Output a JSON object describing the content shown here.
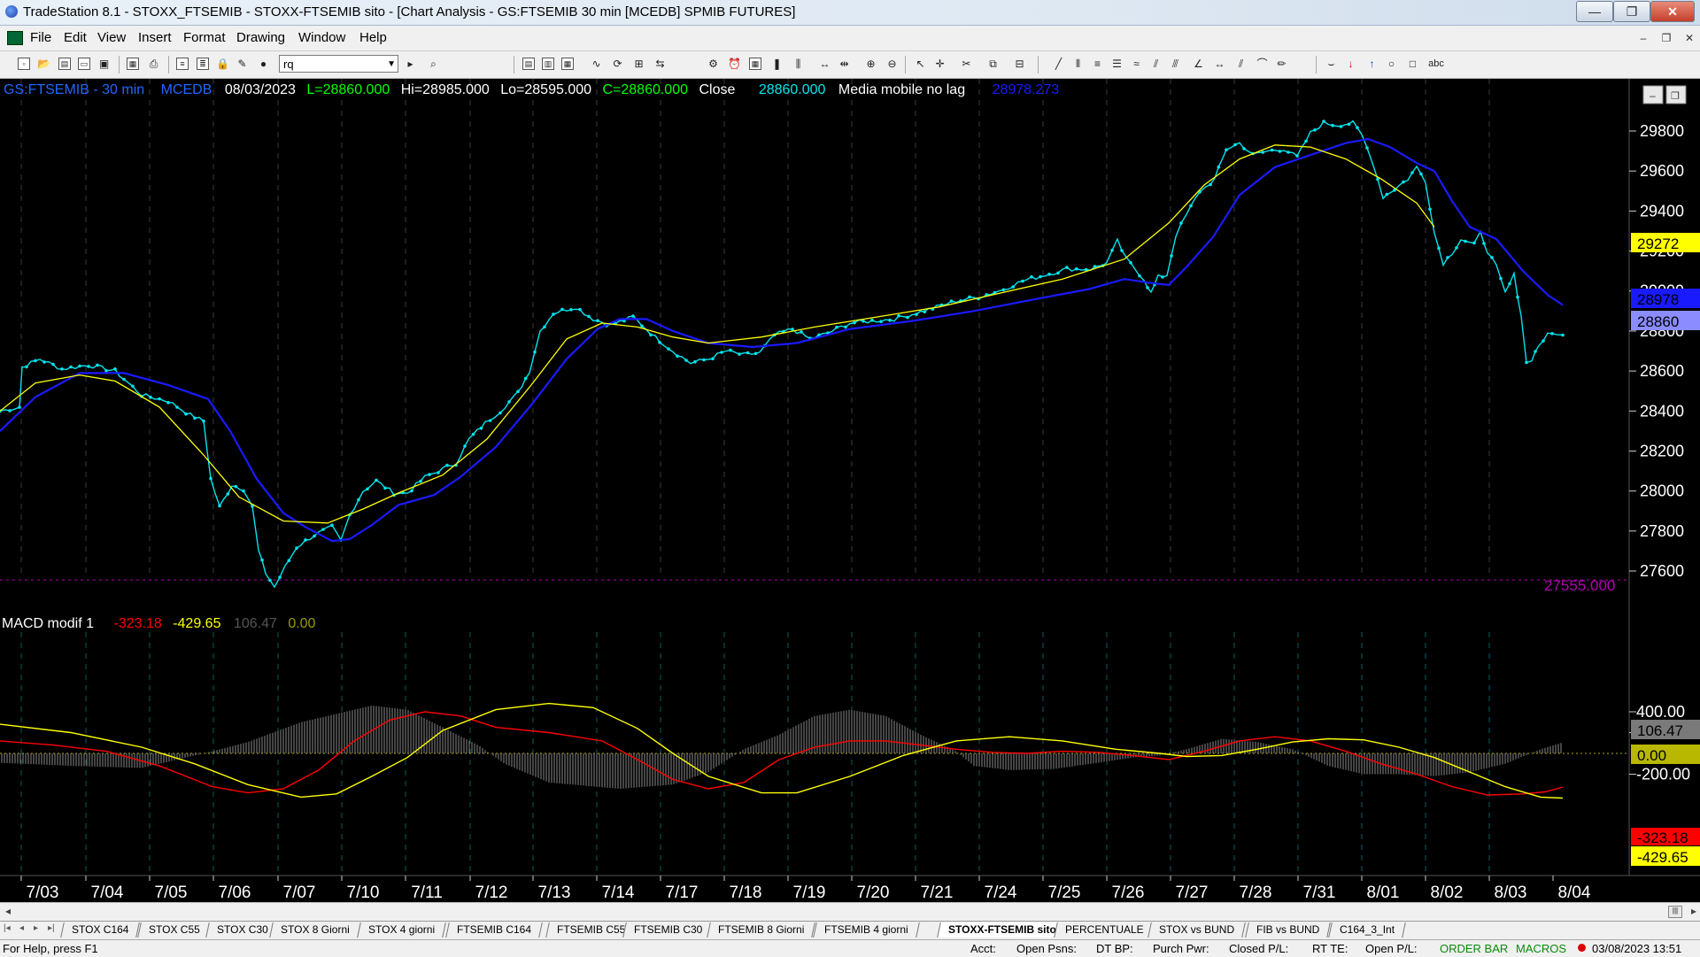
{
  "window": {
    "title": "TradeStation 8.1 - STOXX_FTSEMIB - STOXX-FTSEMIB sito - [Chart Analysis - GS:FTSEMIB  30 min  [MCEDB] SPMIB FUTURES]",
    "minimize_glyph": "—",
    "restore_glyph": "❐",
    "close_glyph": "✕"
  },
  "menu": {
    "items": [
      "File",
      "Edit",
      "View",
      "Insert",
      "Format",
      "Drawing",
      "Window",
      "Help"
    ],
    "mdi_glyphs": [
      "–",
      "❐",
      "✕"
    ]
  },
  "toolbar": {
    "symbol_value": "rq",
    "icons": [
      "new-doc",
      "open",
      "open-workspace",
      "new-window",
      "save",
      "print",
      "print-preview",
      "insert-indicator",
      "insert-strategy",
      "lock",
      "drawing",
      "radar",
      "symbol-lookup",
      "chart-style",
      "bar-style",
      "candle-style",
      "line-style",
      "zoom-in",
      "zoom-out",
      "pointer",
      "crosshair",
      "trendline",
      "horizontal-line",
      "vertical-line",
      "fibonacci",
      "arc",
      "arrow-down",
      "arrow-up",
      "ellipse",
      "rectangle",
      "text"
    ]
  },
  "chart": {
    "header": {
      "symbol_interval": "GS:FTSEMIB - 30 min",
      "exchange": "MCEDB",
      "date": "08/03/2023",
      "last": "L=28860.000",
      "high": "Hi=28985.000",
      "low": "Lo=28595.000",
      "close_eq": "C=28860.000",
      "close_label": "Close",
      "close_value": "28860.000",
      "indicator_name": "Media mobile no lag",
      "indicator_value": "28978.273"
    },
    "price_axis_ticks": [
      "29800",
      "29600",
      "29400",
      "29200",
      "29000",
      "28800",
      "28600",
      "28400",
      "28200",
      "28000",
      "27800",
      "27600"
    ],
    "price_markers": {
      "yellow": "29272",
      "blue": "28978",
      "last": "28860",
      "purple_line": "27555.000"
    },
    "macd": {
      "name": "MACD modif 1",
      "macd_value": "-323.18",
      "signal_value": "-429.65",
      "hist_value": "106.47",
      "zero_value": "0.00",
      "axis_ticks": [
        "400.00",
        "200.00",
        "-200.00"
      ]
    },
    "date_labels": [
      "7/03",
      "7/04",
      "7/05",
      "7/06",
      "7/07",
      "7/10",
      "7/11",
      "7/12",
      "7/13",
      "7/14",
      "7/17",
      "7/18",
      "7/19",
      "7/20",
      "7/21",
      "7/24",
      "7/25",
      "7/26",
      "7/27",
      "7/28",
      "7/31",
      "8/01",
      "8/02",
      "8/03",
      "8/04"
    ],
    "colors": {
      "price_dots": "#00e5ee",
      "ma_blue": "#1a1aff",
      "ma_yellow": "#ffff00",
      "macd_red": "#ff0000",
      "signal_yellow": "#ffff00",
      "hist_gray": "#8a8a8a",
      "header_green": "#00ff00",
      "header_blue": "#2266ff",
      "purple": "#b000b0"
    }
  },
  "tabs": {
    "nav_glyphs": [
      "|◂",
      "◂",
      "▸",
      "▸|"
    ],
    "items": [
      "STOX C164",
      "STOX C55",
      "STOX  C30",
      "STOX  8 Giorni",
      "STOX 4 giorni",
      "FTSEMIB C164",
      "FTSEMIB C55",
      "FTSEMIB C30",
      "FTSEMIB  8 Giorni",
      "FTSEMIB  4 giorni",
      "STOXX-FTSEMIB sito",
      "PERCENTUALE",
      "STOX vs BUND",
      "FIB vs BUND",
      "C164_3_Int"
    ],
    "active": "STOXX-FTSEMIB sito"
  },
  "status": {
    "help": "For Help, press F1",
    "acct": "Acct:",
    "open_psns": "Open Psns:",
    "dt_bp": "DT BP:",
    "purch_pwr": "Purch Pwr:",
    "closed_pl": "Closed P/L:",
    "rt_te": "RT TE:",
    "open_pl": "Open P/L:",
    "order_bar": "ORDER BAR",
    "macros": "MACROS",
    "datetime": "03/08/2023 13:51"
  }
}
